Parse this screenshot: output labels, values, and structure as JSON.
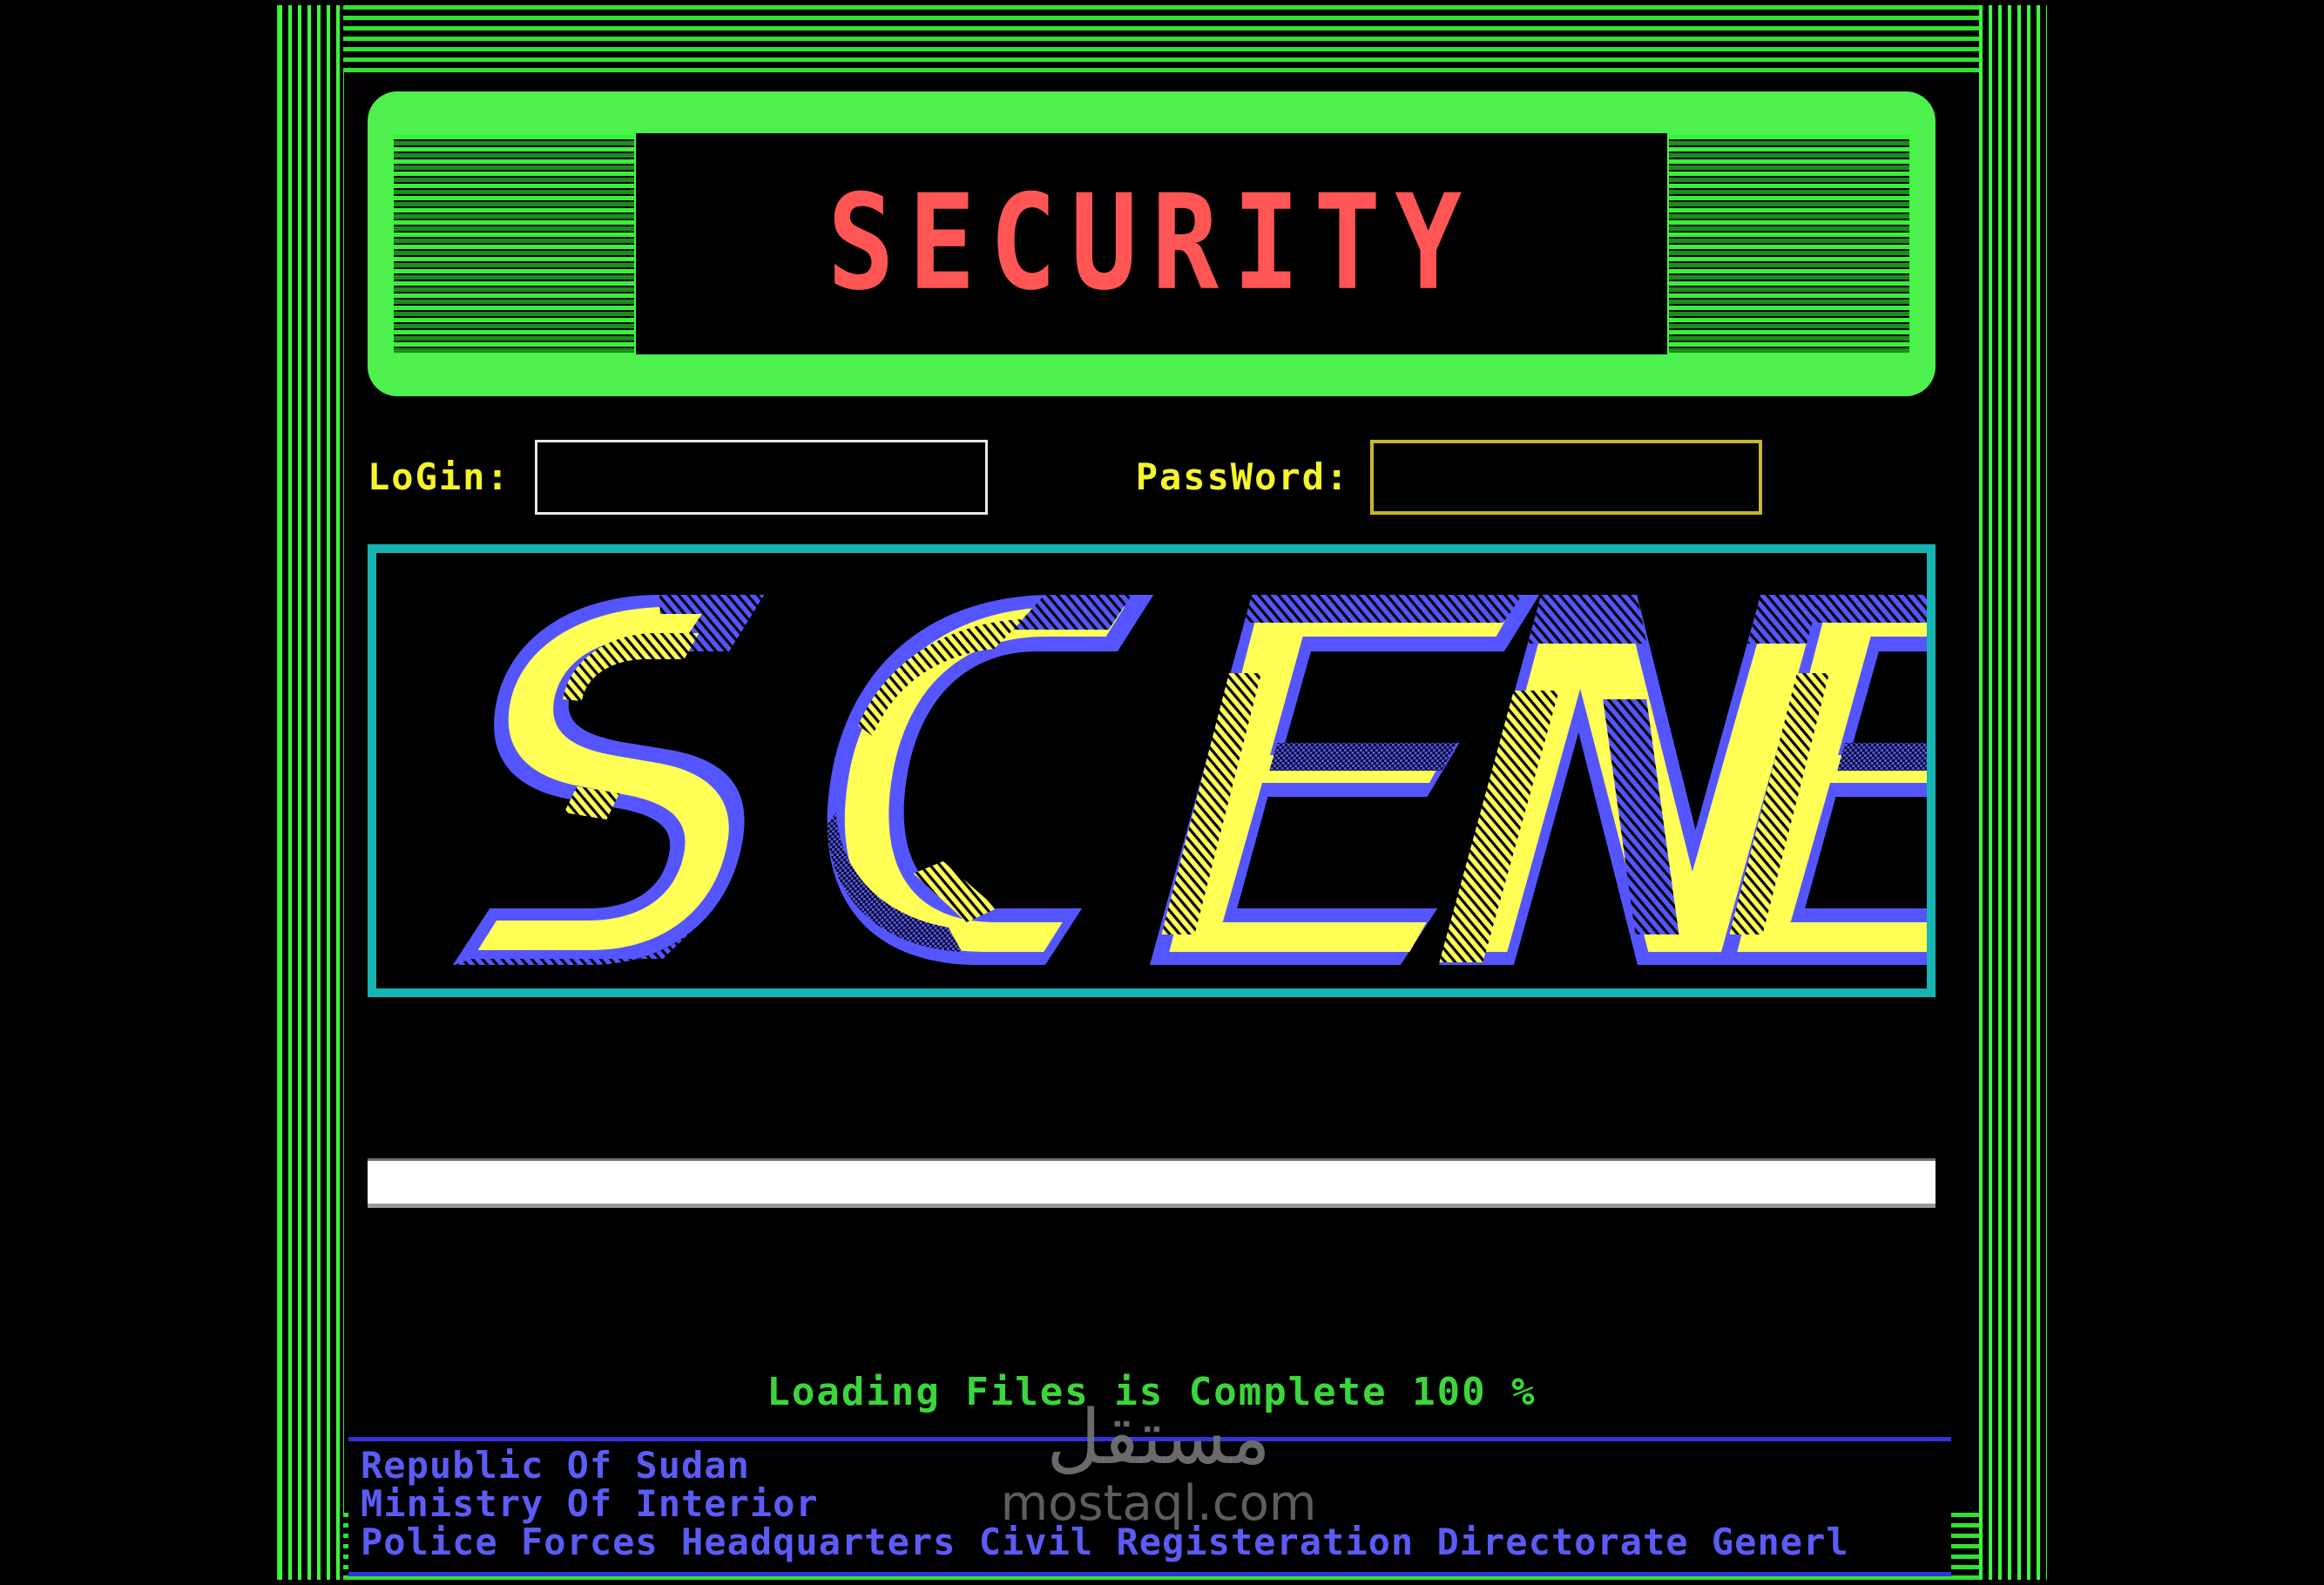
{
  "app": {
    "title": "SECURITY",
    "logo_word": "SCENE"
  },
  "credentials": {
    "login_label": "LoGin:",
    "login_value": "",
    "login_placeholder": "",
    "password_label": "PassWord:",
    "password_value": "",
    "password_placeholder": ""
  },
  "progress": {
    "percent": 100,
    "fill_width": "100%",
    "status_text": "Loading Files is Complete 100 %"
  },
  "footer": {
    "line1": "Republic Of Sudan",
    "line2": "Ministry Of Interior",
    "line3": "Police Forces Headquarters Civil Registeration Directorate Generl"
  },
  "watermark": {
    "arabic": "مستقل",
    "url": "mostaql.com"
  },
  "colors": {
    "background": "#000000",
    "frame_green": "#2FE32F",
    "banner_green": "#4DF04D",
    "title_red": "#FF5555",
    "label_yellow": "#F5F52A",
    "login_border": "#E8E8E8",
    "password_border": "#C9B52B",
    "scene_border_teal": "#16B3B3",
    "scene_blue": "#5555FF",
    "scene_yellow": "#FFFF55",
    "progress_fill": "#FFFFFF",
    "status_green": "#3BD63B",
    "footer_blue": "#5B5BF5"
  }
}
